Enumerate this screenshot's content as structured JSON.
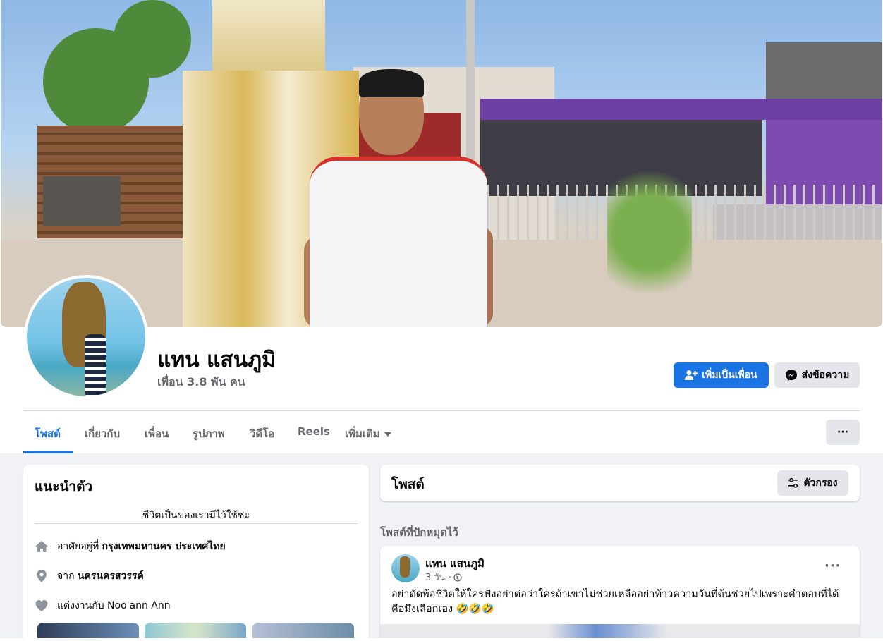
{
  "profile": {
    "name": "แทน แสนภูมิ",
    "friends_count": "เพื่อน 3.8 พัน คน",
    "add_friend_label": "เพิ่มเป็นเพื่อน",
    "message_label": "ส่งข้อความ"
  },
  "tabs": [
    {
      "label": "โพสต์",
      "active": true
    },
    {
      "label": "เกี่ยวกับ"
    },
    {
      "label": "เพื่อน"
    },
    {
      "label": "รูปภาพ"
    },
    {
      "label": "วิดีโอ"
    },
    {
      "label": "Reels"
    },
    {
      "label": "เพิ่มเติม",
      "has_dropdown": true
    }
  ],
  "more_options_label": "···",
  "intro": {
    "title": "แนะนำตัว",
    "bio": "ชีวิตเป็นของเรามีไว้ใช้ซะ",
    "items": [
      {
        "icon": "home-icon",
        "prefix": "อาศัยอยู่ที่",
        "value": "กรุงเทพมหานคร ประเทศไทย"
      },
      {
        "icon": "location-pin-icon",
        "prefix": "จาก",
        "value": "นครนครสวรรค์"
      },
      {
        "icon": "heart-icon",
        "prefix": "แต่งงานกับ",
        "value": "Noo'ann Ann"
      }
    ]
  },
  "posts_section": {
    "title": "โพสต์",
    "filter_label": "ตัวกรอง",
    "pinned_label": "โพสต์ที่ปักหมุดไว้"
  },
  "post": {
    "author": "แทน แสนภูมิ",
    "time": "3 วัน ·",
    "privacy_icon": "globe-icon",
    "text": "อย่าตัดพ้อชีวิตให้ใครฟังอย่าต่อว่าใครถ้าเขาไม่ช่วยเหลืออย่าท้าวความวันที่ต้นช่วยไปเพราะคำตอบที่ได้คือมึงเลือกเอง 🤣🤣🤣"
  },
  "colors": {
    "accent": "#1b74e4",
    "secondary_text": "#65676b",
    "page_background": "#f0f2f5",
    "button_gray": "#e4e6eb"
  }
}
